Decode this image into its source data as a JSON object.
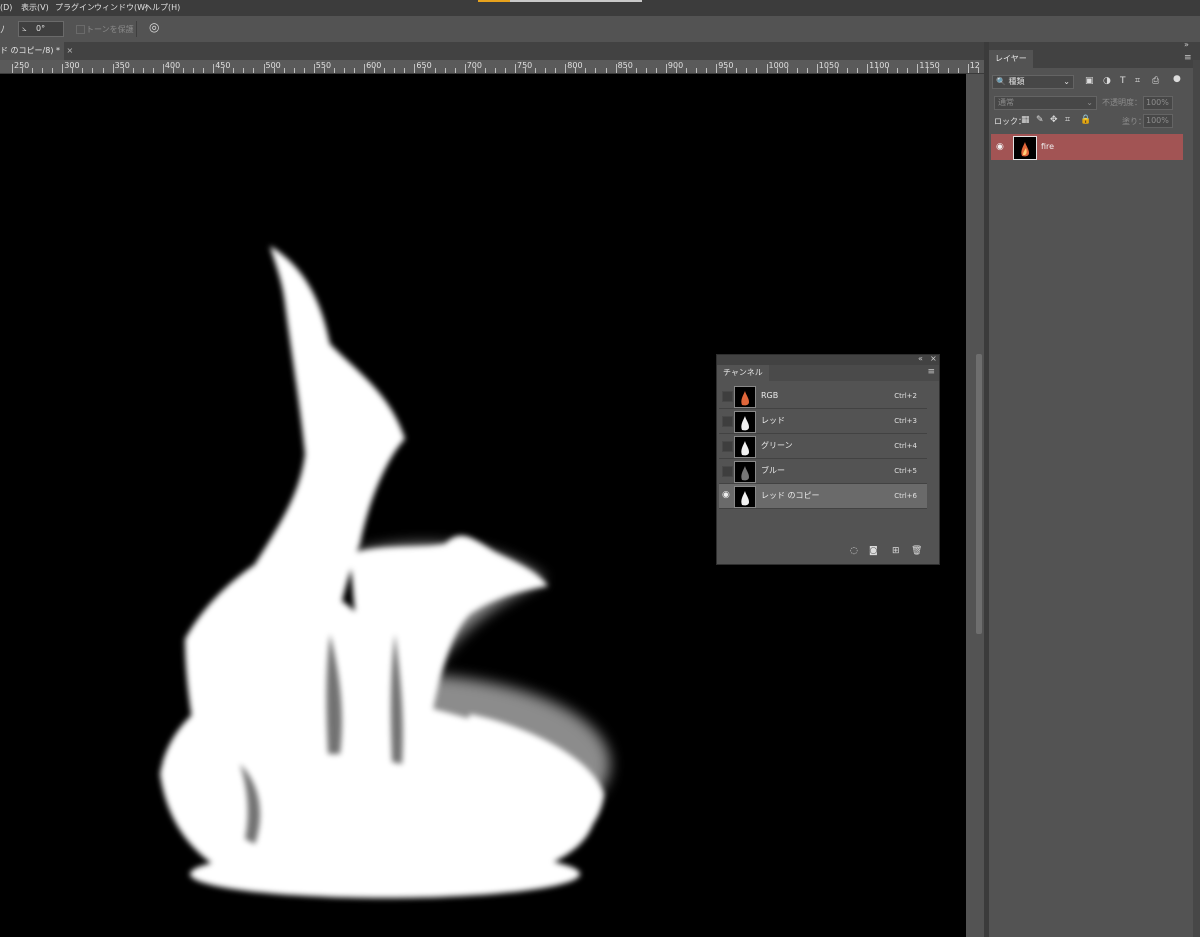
{
  "menu": {
    "items": [
      "(D)",
      "表示(V)",
      "プラグイン",
      "ウィンドウ(W)",
      "ヘルプ(H)"
    ]
  },
  "options": {
    "angle_value": "0°",
    "preserve_tones_label": "トーンを保護"
  },
  "document": {
    "tab_title": "ド のコピー/8) *"
  },
  "ruler": {
    "labels": [
      "250",
      "300",
      "350",
      "400",
      "450",
      "500",
      "550",
      "600",
      "650",
      "700",
      "750",
      "800",
      "850",
      "900",
      "950",
      "1000",
      "1050",
      "1100",
      "1150",
      "12"
    ]
  },
  "channels_panel": {
    "tab_label": "チャンネル",
    "channels": [
      {
        "name": "RGB",
        "shortcut": "Ctrl+2",
        "visible": false,
        "selected": false,
        "thumb": "color"
      },
      {
        "name": "レッド",
        "shortcut": "Ctrl+3",
        "visible": false,
        "selected": false,
        "thumb": "white"
      },
      {
        "name": "グリーン",
        "shortcut": "Ctrl+4",
        "visible": false,
        "selected": false,
        "thumb": "white"
      },
      {
        "name": "ブルー",
        "shortcut": "Ctrl+5",
        "visible": false,
        "selected": false,
        "thumb": "dim"
      },
      {
        "name": "レッド のコピー",
        "shortcut": "Ctrl+6",
        "visible": true,
        "selected": true,
        "thumb": "white"
      }
    ],
    "footer_icons": [
      "load-selection-icon",
      "save-selection-icon",
      "new-channel-icon",
      "delete-channel-icon"
    ]
  },
  "layers_panel": {
    "tab_label": "レイヤー",
    "filter_label": "種類",
    "blend_mode": "通常",
    "opacity_label": "不透明度：",
    "opacity_value": "100%",
    "lock_label": "ロック：",
    "fill_label": "塗り：",
    "fill_value": "100%",
    "layers": [
      {
        "name": "fire",
        "visible": true,
        "selected": true
      }
    ]
  },
  "colors": {
    "ui_bg": "#535353",
    "selected_layer": "#a25454",
    "accent": "#e7a21d"
  }
}
